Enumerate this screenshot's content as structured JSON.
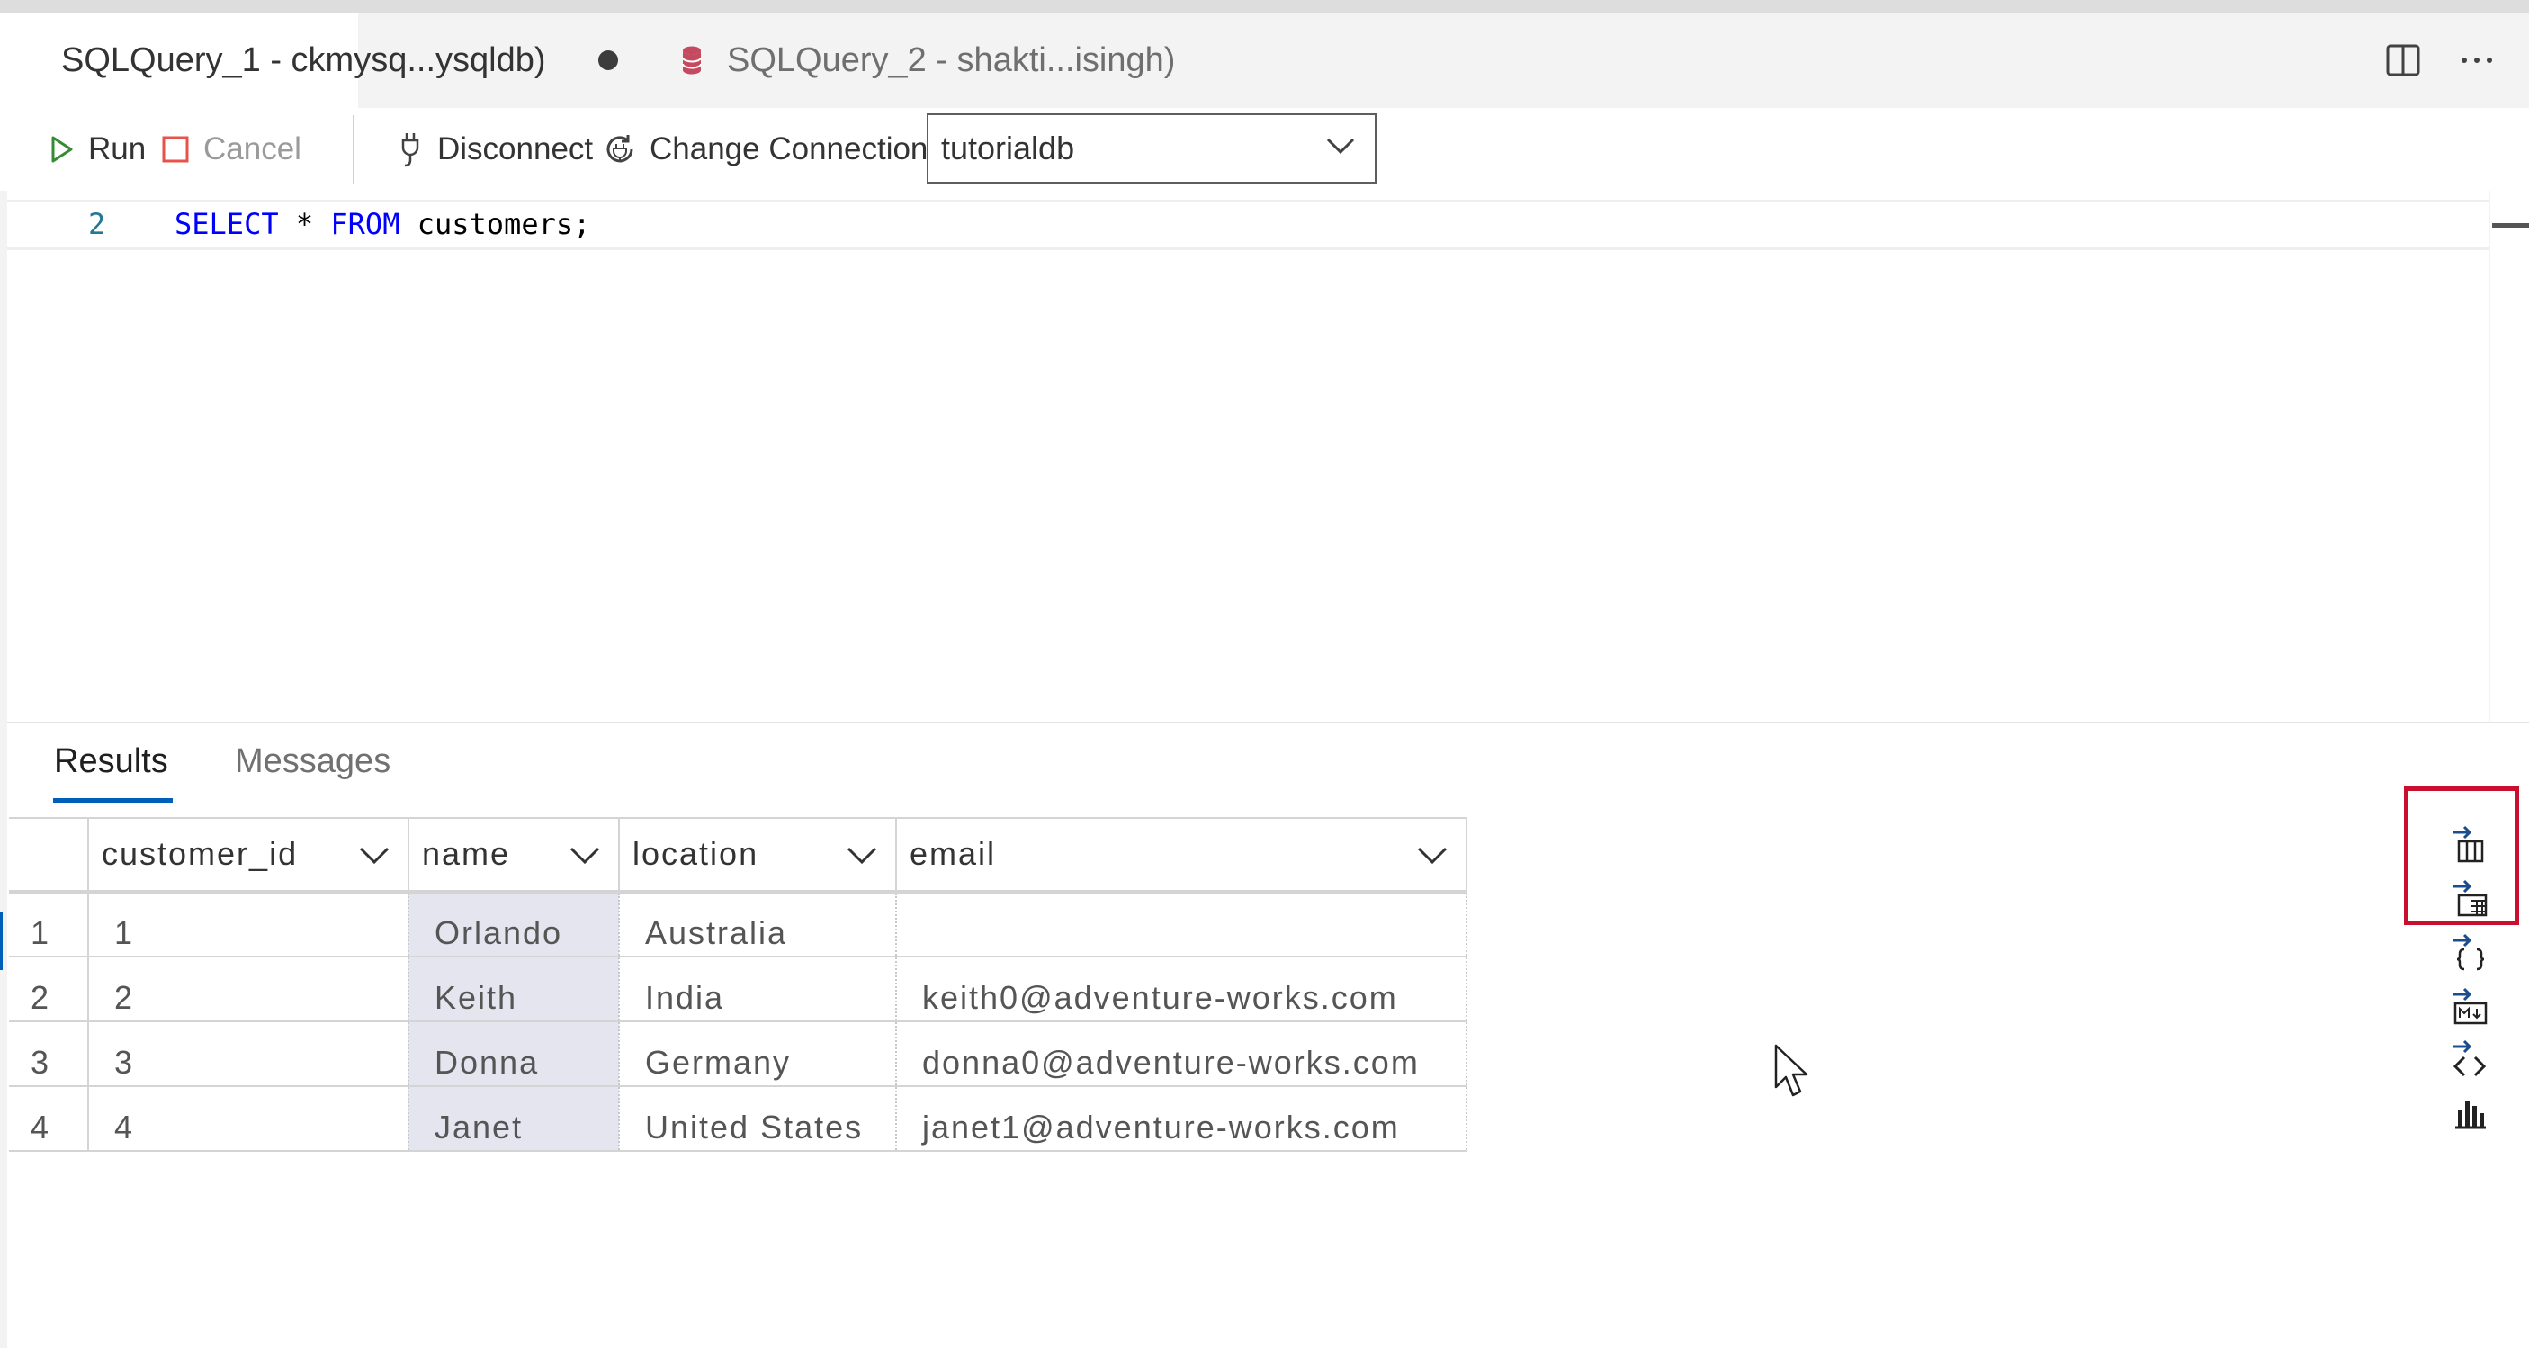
{
  "tabs": [
    {
      "label": "SQLQuery_1 - ckmysq...ysqldb)",
      "active": true,
      "dirty": true
    },
    {
      "label": "SQLQuery_2 - shakti...isingh)",
      "active": false,
      "dirty": false
    }
  ],
  "toolbar": {
    "run_label": "Run",
    "cancel_label": "Cancel",
    "disconnect_label": "Disconnect",
    "change_connection_label": "Change Connection",
    "database_value": "tutorialdb"
  },
  "editor": {
    "line_number": "2",
    "kw_select": "SELECT",
    "star": " * ",
    "kw_from": "FROM",
    "rest": " customers;"
  },
  "results": {
    "tabs": [
      "Results",
      "Messages"
    ],
    "columns": [
      "customer_id",
      "name",
      "location",
      "email"
    ],
    "rows": [
      {
        "num": "1",
        "customer_id": "1",
        "name": "Orlando",
        "location": "Australia",
        "email": ""
      },
      {
        "num": "2",
        "customer_id": "2",
        "name": "Keith",
        "location": "India",
        "email": "keith0@adventure-works.com"
      },
      {
        "num": "3",
        "customer_id": "3",
        "name": "Donna",
        "location": "Germany",
        "email": "donna0@adventure-works.com"
      },
      {
        "num": "4",
        "customer_id": "4",
        "name": "Janet",
        "location": "United States",
        "email": "janet1@adventure-works.com"
      }
    ]
  },
  "rail_icons": [
    "save-as-csv-icon",
    "save-as-excel-icon",
    "save-as-json-icon",
    "save-as-markdown-icon",
    "save-as-xml-icon",
    "chart-icon"
  ],
  "colors": {
    "accent": "#005fb8",
    "highlight": "#c8102e",
    "db_icon": "#c5495f",
    "run_green": "#388a34",
    "cancel_red": "#e5534b"
  }
}
